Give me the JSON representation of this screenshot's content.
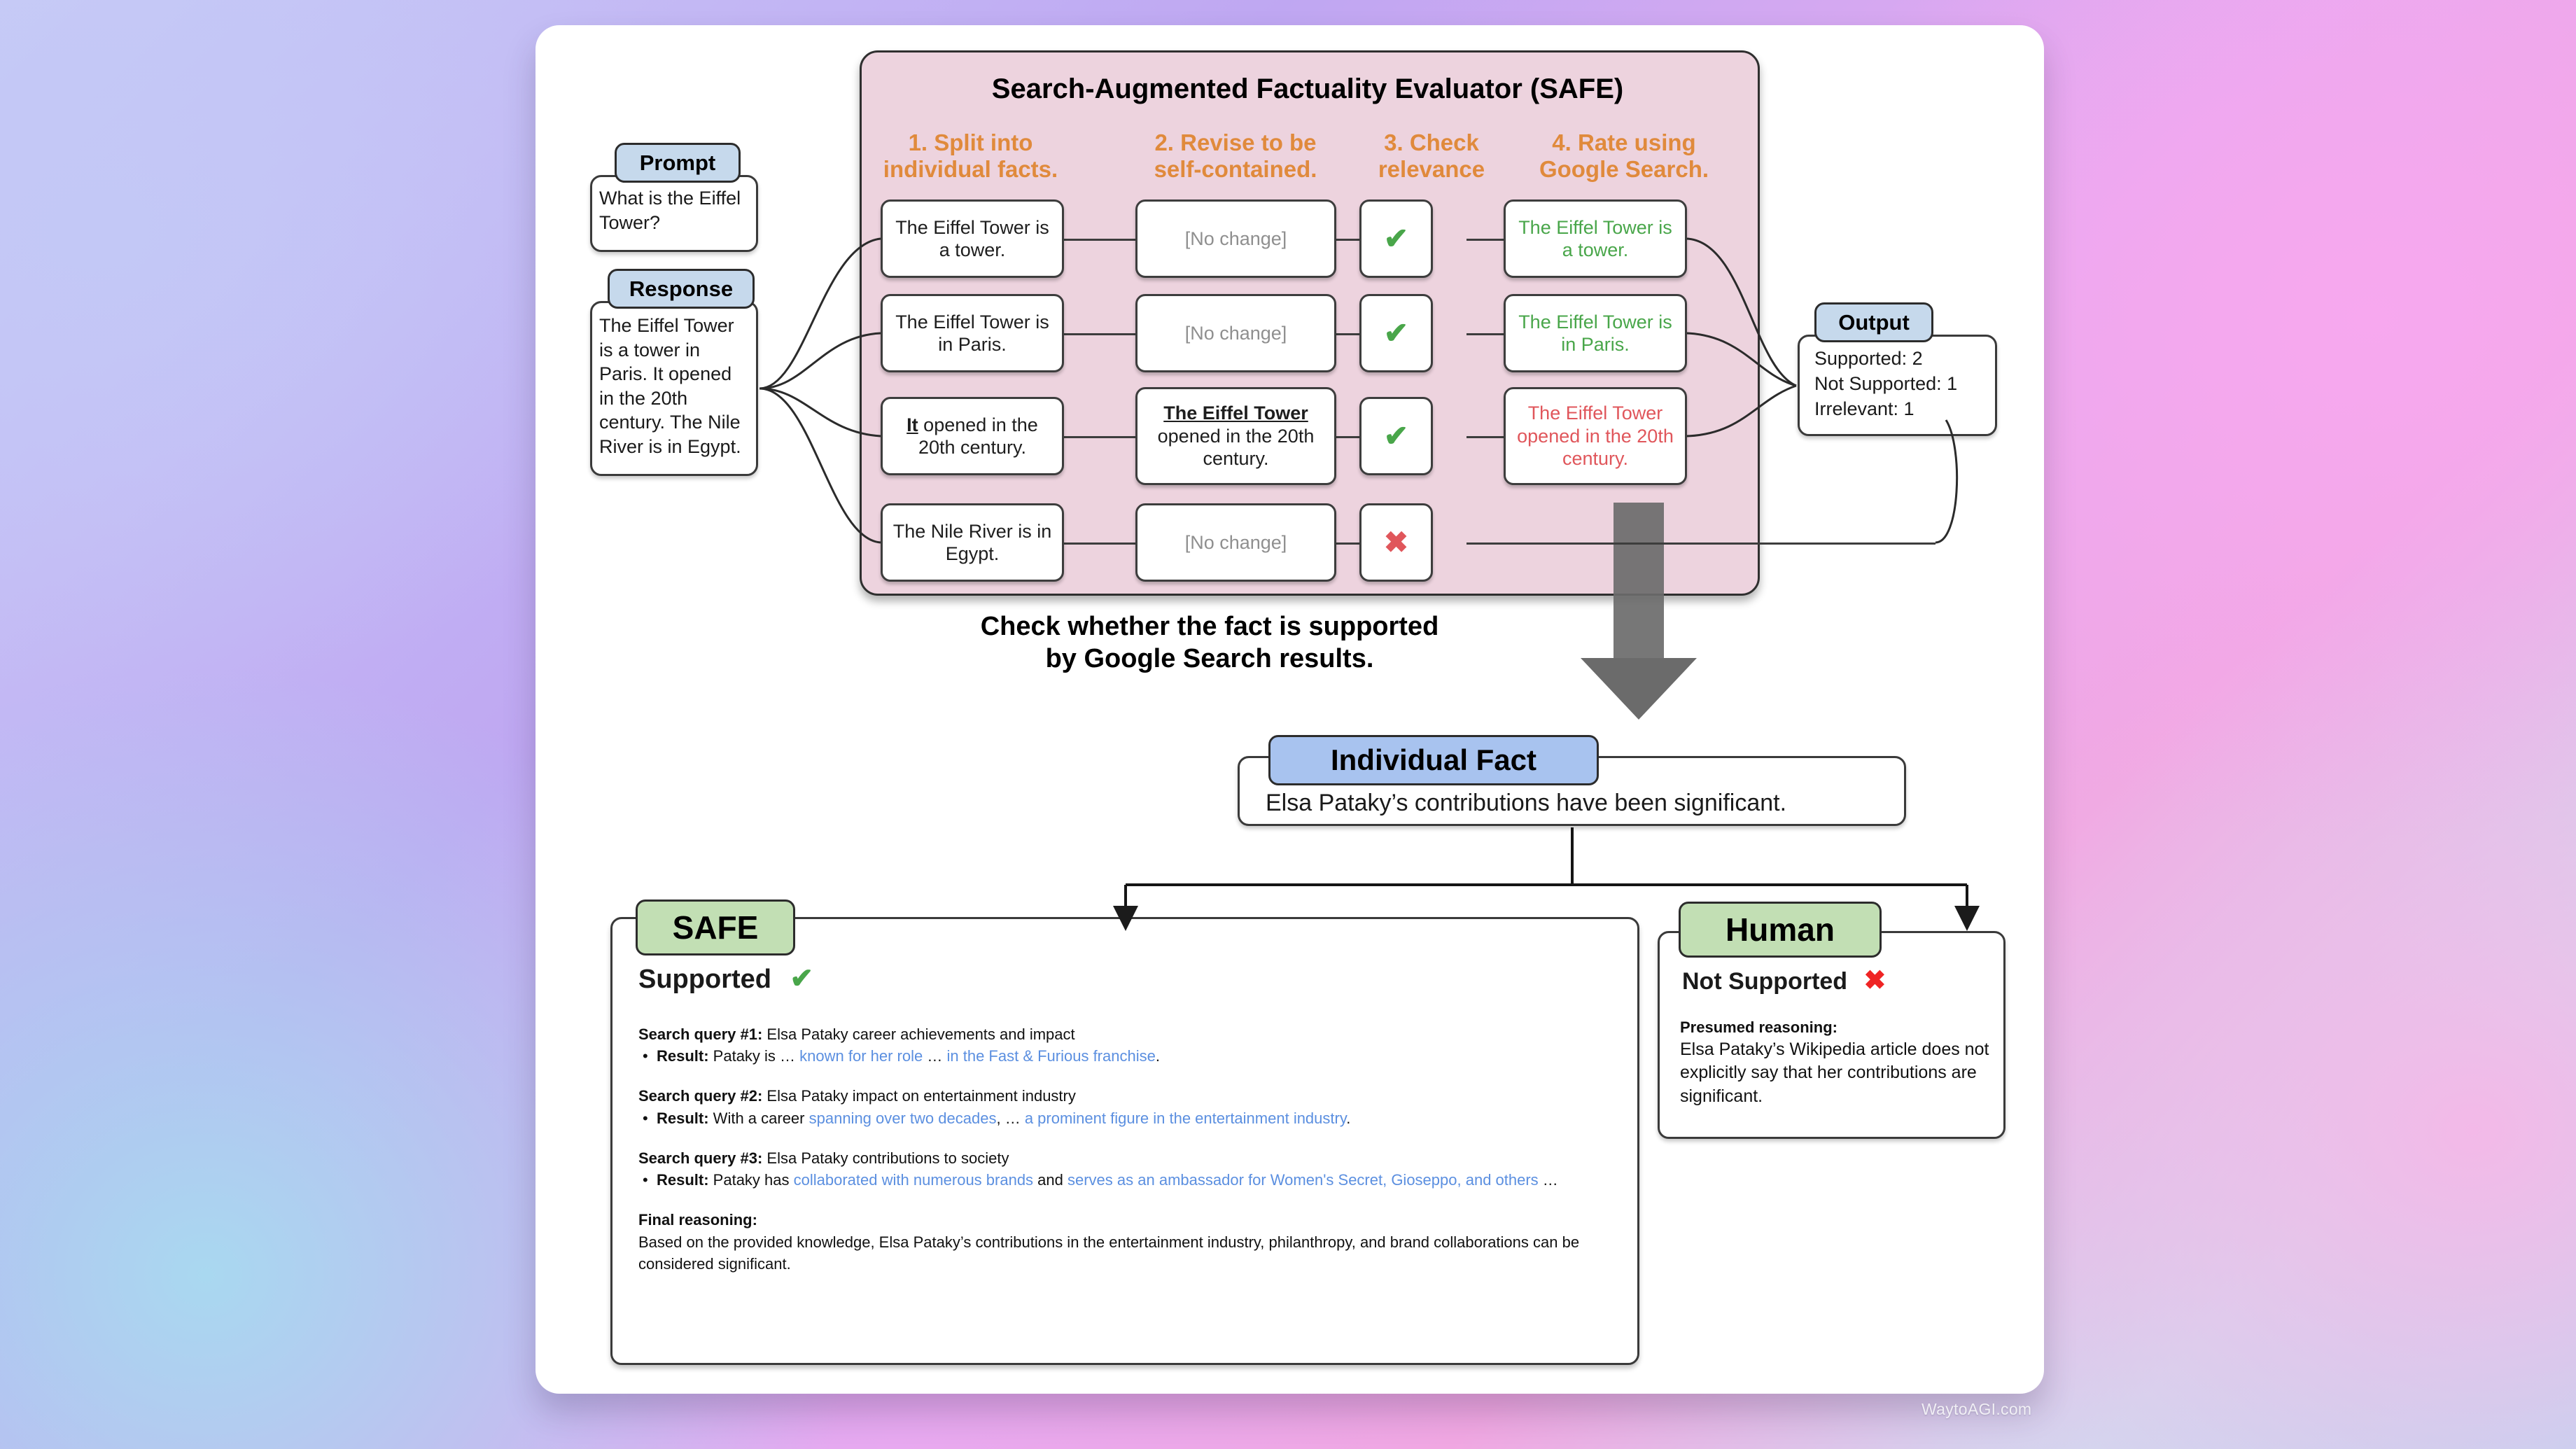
{
  "watermark": "WaytoAGI.com",
  "colors": {
    "panel_pink": "#edd3de",
    "orange_heading": "#e08a3c",
    "green_text": "#49a64a",
    "red_text": "#e0565b",
    "tag_blue": "#c6d9ec",
    "tag_blue_strong": "#a8c3ef",
    "tag_green": "#c2dfb4",
    "link_blue": "#5b8fe0",
    "arrow_gray": "#6b6b6b"
  },
  "safe_panel": {
    "title": "Search-Augmented Factuality Evaluator (SAFE)",
    "column_headings": [
      "1. Split into individual facts.",
      "2. Revise to be self-contained.",
      "3. Check relevance",
      "4. Rate using Google Search."
    ],
    "rows": [
      {
        "split": "The Eiffel Tower is a tower.",
        "revise": "[No change]",
        "relevance": "✔",
        "relevance_name": "check-mark",
        "rating": "The Eiffel Tower is a tower.",
        "rating_style": "green"
      },
      {
        "split": "The Eiffel Tower is in Paris.",
        "revise": "[No change]",
        "relevance": "✔",
        "relevance_name": "check-mark",
        "rating": "The Eiffel Tower is in Paris.",
        "rating_style": "green"
      },
      {
        "split_prefix": "It",
        "split_rest": " opened in the 20th century.",
        "split": "It opened in the 20th century.",
        "revise_prefix": "The Eiffel Tower",
        "revise_rest": "opened in the 20th century.",
        "revise": "The Eiffel Tower opened in the 20th century.",
        "relevance": "✔",
        "relevance_name": "check-mark",
        "rating": "The Eiffel Tower opened in the 20th century.",
        "rating_style": "red"
      },
      {
        "split": "The Nile River is in Egypt.",
        "revise": "[No change]",
        "relevance": "✖",
        "relevance_name": "cross-mark",
        "rating": "",
        "rating_style": "none"
      }
    ]
  },
  "prompt": {
    "tag": "Prompt",
    "text": "What is the Eiffel Tower?"
  },
  "response": {
    "tag": "Response",
    "text": "The Eiffel Tower is a tower in Paris. It opened in the 20th century. The Nile River is in Egypt."
  },
  "output": {
    "tag": "Output",
    "lines": [
      "Supported: 2",
      "Not Supported: 1",
      "Irrelevant: 1"
    ]
  },
  "caption": "Check whether the fact is supported by Google Search results.",
  "individual_fact": {
    "tag": "Individual Fact",
    "text": "Elsa Pataky’s contributions have been significant."
  },
  "safe_result": {
    "tag": "SAFE",
    "verdict": "Supported",
    "verdict_icon": "✔",
    "queries": [
      {
        "label": "Search query #1:",
        "query": " Elsa Pataky career achievements and impact",
        "result_label": "Result:",
        "result_parts": [
          {
            "t": " Pataky is … ",
            "link": false
          },
          {
            "t": "known for her role",
            "link": true
          },
          {
            "t": " … ",
            "link": false
          },
          {
            "t": "in the Fast & Furious franchise",
            "link": true
          },
          {
            "t": ".",
            "link": false
          }
        ]
      },
      {
        "label": "Search query #2:",
        "query": " Elsa Pataky impact on entertainment industry",
        "result_label": "Result:",
        "result_parts": [
          {
            "t": " With a career ",
            "link": false
          },
          {
            "t": "spanning over two decades",
            "link": true
          },
          {
            "t": ", … ",
            "link": false
          },
          {
            "t": "a prominent figure in the entertainment industry",
            "link": true
          },
          {
            "t": ".",
            "link": false
          }
        ]
      },
      {
        "label": "Search query #3:",
        "query": " Elsa Pataky contributions to society",
        "result_label": "Result:",
        "result_parts": [
          {
            "t": " Pataky has ",
            "link": false
          },
          {
            "t": "collaborated with numerous brands",
            "link": true
          },
          {
            "t": " and ",
            "link": false
          },
          {
            "t": "serves as an ambassador for Women's Secret, Gioseppo, and others",
            "link": true
          },
          {
            "t": " …",
            "link": false
          }
        ]
      }
    ],
    "final_label": "Final reasoning:",
    "final_text": "Based on the provided knowledge, Elsa Pataky’s contributions in the entertainment industry, philanthropy, and brand collaborations can be considered significant."
  },
  "human_result": {
    "tag": "Human",
    "verdict": "Not Supported",
    "verdict_icon": "✖",
    "reason_label": "Presumed reasoning:",
    "reason_text": "Elsa Pataky’s Wikipedia article does not explicitly say that her contributions are significant."
  }
}
